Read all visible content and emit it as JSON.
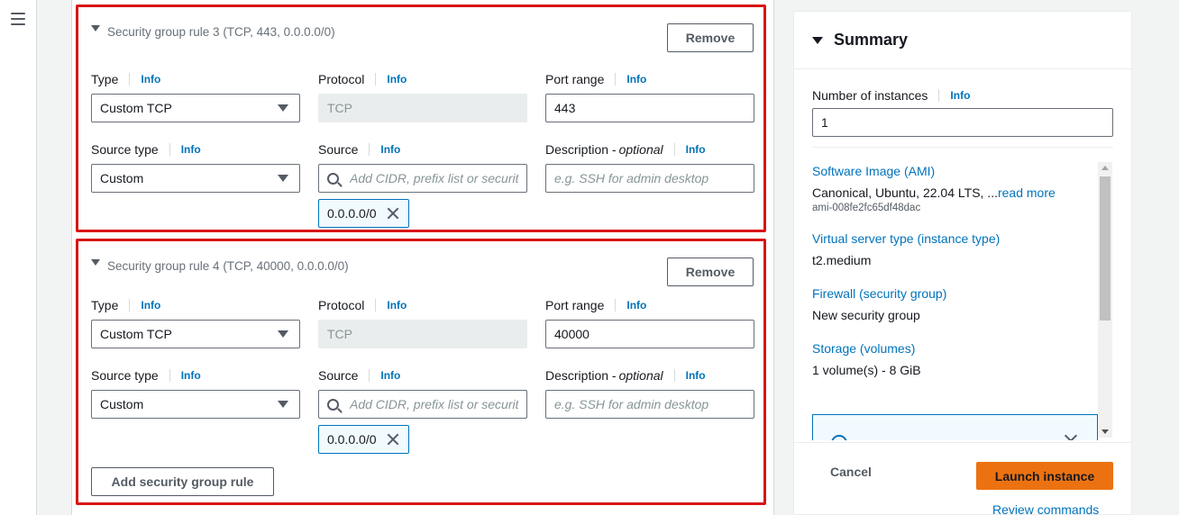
{
  "rules": [
    {
      "title": "Security group rule 3 (TCP, 443, 0.0.0.0/0)",
      "remove_label": "Remove",
      "type_label": "Type",
      "type_value": "Custom TCP",
      "protocol_label": "Protocol",
      "protocol_value": "TCP",
      "port_label": "Port range",
      "port_value": "443",
      "source_type_label": "Source type",
      "source_type_value": "Custom",
      "source_label": "Source",
      "source_placeholder": "Add CIDR, prefix list or security",
      "desc_label": "Description -",
      "desc_optional": "optional",
      "desc_placeholder": "e.g. SSH for admin desktop",
      "token": "0.0.0.0/0"
    },
    {
      "title": "Security group rule 4 (TCP, 40000, 0.0.0.0/0)",
      "remove_label": "Remove",
      "type_label": "Type",
      "type_value": "Custom TCP",
      "protocol_label": "Protocol",
      "protocol_value": "TCP",
      "port_label": "Port range",
      "port_value": "40000",
      "source_type_label": "Source type",
      "source_type_value": "Custom",
      "source_label": "Source",
      "source_placeholder": "Add CIDR, prefix list or security",
      "desc_label": "Description -",
      "desc_optional": "optional",
      "desc_placeholder": "e.g. SSH for admin desktop",
      "token": "0.0.0.0/0"
    }
  ],
  "info_label": "Info",
  "add_rule_label": "Add security group rule",
  "summary": {
    "title": "Summary",
    "instances_label": "Number of instances",
    "instances_value": "1",
    "ami_link": "Software Image (AMI)",
    "ami_value": "Canonical, Ubuntu, 22.04 LTS, ...",
    "ami_read_more": "read more",
    "ami_id": "ami-008fe2fc65df48dac",
    "instance_type_link": "Virtual server type (instance type)",
    "instance_type_value": "t2.medium",
    "firewall_link": "Firewall (security group)",
    "firewall_value": "New security group",
    "storage_link": "Storage (volumes)",
    "storage_value": "1 volume(s) - 8 GiB",
    "cancel_label": "Cancel",
    "launch_label": "Launch instance",
    "review_label": "Review commands"
  },
  "colors": {
    "highlight_border": "#d91515",
    "link": "#0073bb",
    "primary_button": "#ec7211"
  },
  "icons": [
    "menu-icon",
    "caret-down-icon",
    "search-icon",
    "close-icon",
    "info-circle-icon",
    "chevron-down-icon"
  ]
}
